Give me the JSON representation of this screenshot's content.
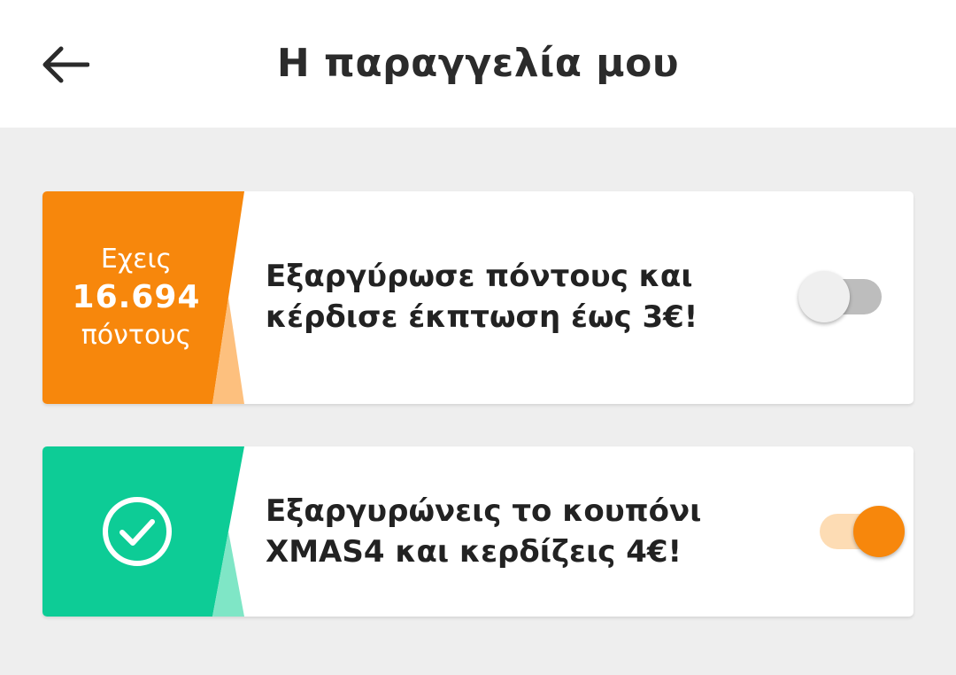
{
  "header": {
    "title": "Η παραγγελία μου",
    "back_icon": "arrow-left-icon"
  },
  "points_card": {
    "label_top": "Εχεις",
    "points": "16.694",
    "label_bottom": "πόντους",
    "message_line1": "Εξαργύρωσε πόντους και",
    "message_line2": "κέρδισε έκπτωση έως 3€!",
    "toggle_on": false,
    "accent_color": "#f7870c",
    "accent_light_color": "#fdc07e"
  },
  "coupon_card": {
    "icon": "check-circle-icon",
    "message_line1": "Εξαργυρώνεις το κουπόνι",
    "message_line2": "XMAS4 και κερδίζεις 4€!",
    "toggle_on": true,
    "accent_color": "#0dcc96",
    "accent_light_color": "#7fe6c6"
  },
  "colors": {
    "background": "#eeeeee",
    "toggle_on_thumb": "#f7870c",
    "toggle_on_track": "#fddcb4",
    "toggle_off_thumb": "#efefef",
    "toggle_off_track": "#bdbdbd"
  }
}
